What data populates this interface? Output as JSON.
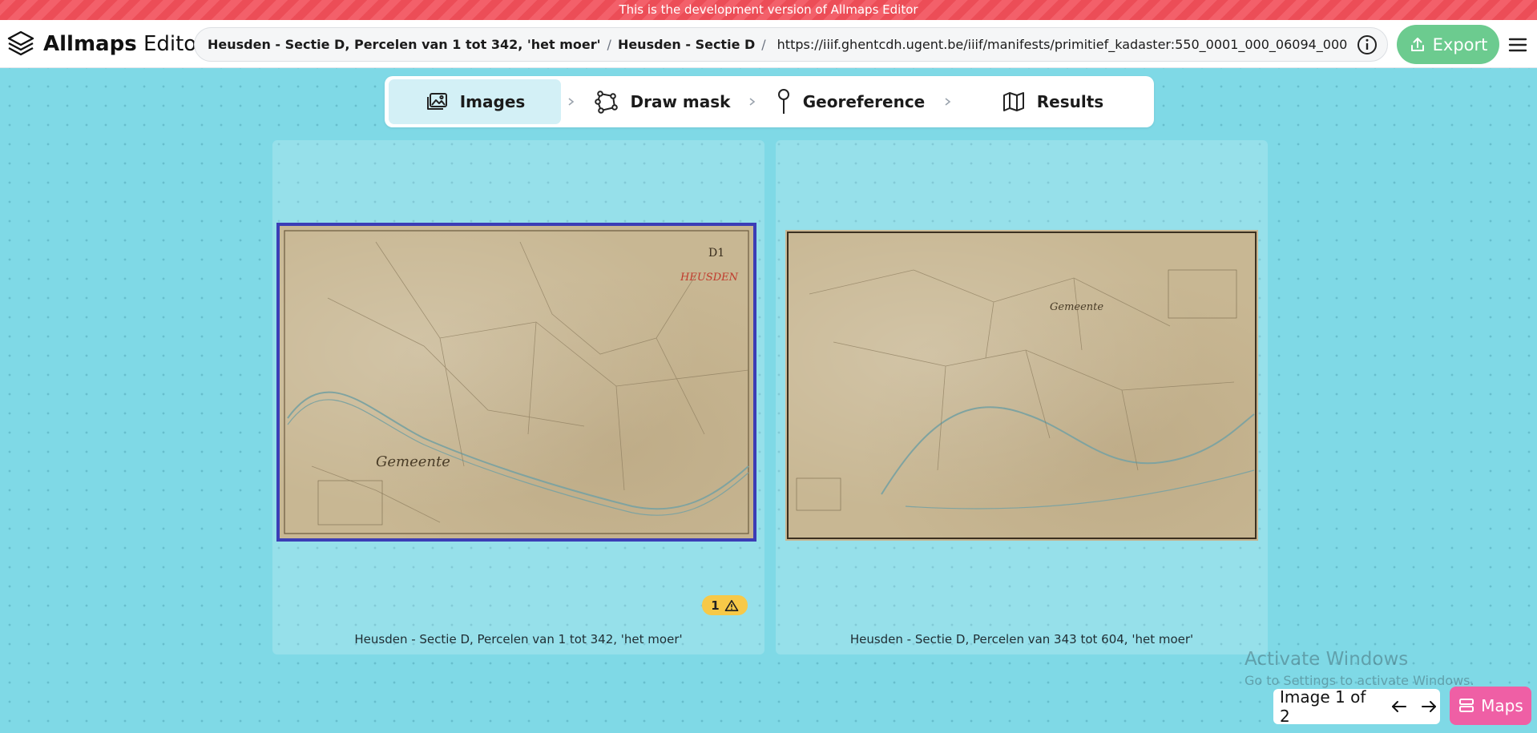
{
  "banner": "This is the development version of Allmaps Editor",
  "app": {
    "brand_bold": "Allmaps",
    "brand_light": "Editor"
  },
  "breadcrumb": {
    "items": [
      "Heusden - Sectie D, Percelen van 1 tot 342, 'het moer'",
      "Heusden - Sectie D"
    ],
    "separator": "/",
    "url": "https://iiif.ghentcdh.ugent.be/iiif/manifests/primitief_kadaster:550_0001_000_06094_000"
  },
  "header": {
    "export_label": "Export",
    "info_icon": "info-icon",
    "menu_icon": "hamburger-menu-icon"
  },
  "steps": [
    {
      "label": "Images",
      "icon": "images-icon",
      "active": true
    },
    {
      "label": "Draw mask",
      "icon": "polygon-icon",
      "active": false
    },
    {
      "label": "Georeference",
      "icon": "pin-icon",
      "active": false
    },
    {
      "label": "Results",
      "icon": "map-icon",
      "active": false
    }
  ],
  "images": [
    {
      "caption": "Heusden - Sectie D, Percelen van 1 tot 342, 'het moer'",
      "selected": true,
      "warnings": "1"
    },
    {
      "caption": "Heusden - Sectie D, Percelen van 343 tot 604, 'het moer'",
      "selected": false
    }
  ],
  "watermark": {
    "line1": "Activate Windows",
    "line2": "Go to Settings to activate Windows."
  },
  "pager": {
    "label": "Image 1 of 2"
  },
  "maps_button": {
    "label": "Maps"
  },
  "colors": {
    "background": "#7fd9e6",
    "export": "#6ccb8f",
    "maps": "#ef5fa5",
    "selection": "#3b3db6",
    "warning": "#f7c948",
    "active_step": "#d3f0f6"
  }
}
